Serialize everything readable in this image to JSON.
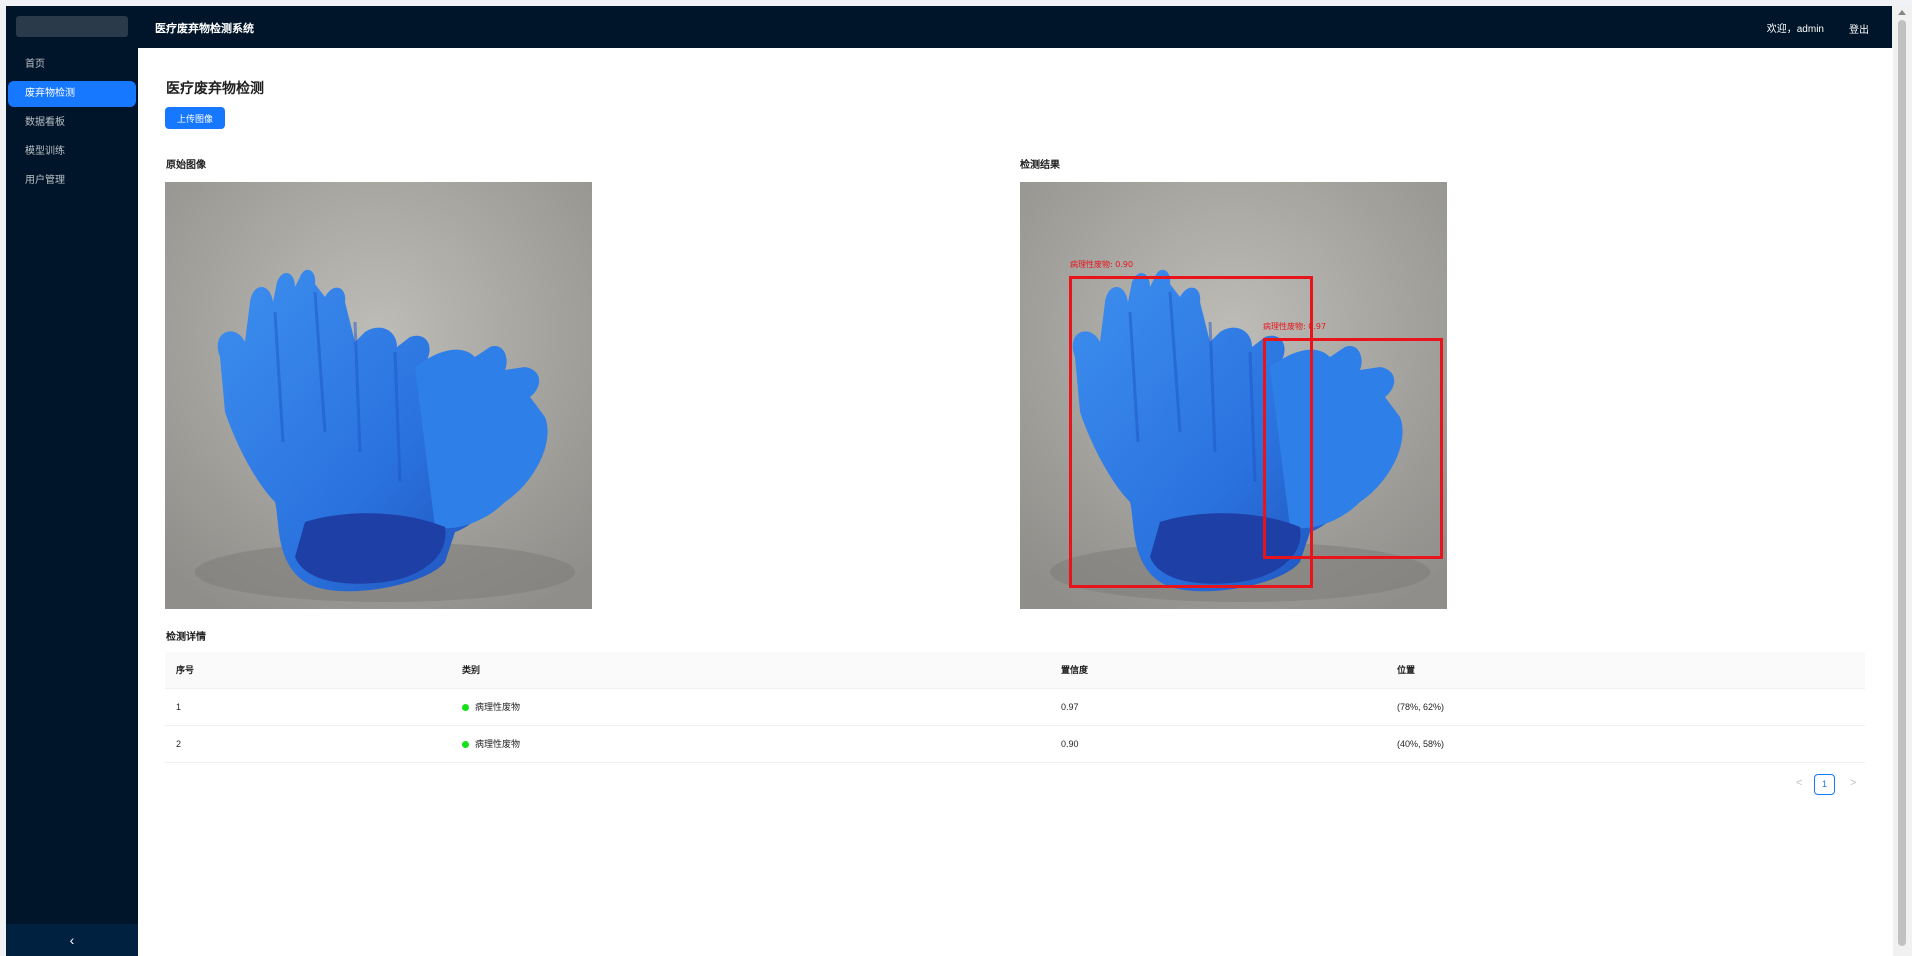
{
  "header": {
    "app_title": "医疗废弃物检测系统",
    "welcome": "欢迎，admin",
    "logout_label": "登出"
  },
  "sidebar": {
    "items": [
      {
        "label": "首页",
        "active": false
      },
      {
        "label": "废弃物检测",
        "active": true
      },
      {
        "label": "数据看板",
        "active": false
      },
      {
        "label": "模型训练",
        "active": false
      },
      {
        "label": "用户管理",
        "active": false
      }
    ],
    "collapse_icon": "chevron-left-icon",
    "collapse_glyph": "‹"
  },
  "main": {
    "page_title": "医疗废弃物检测",
    "upload_label": "上传图像",
    "original_label": "原始图像",
    "result_label": "检测结果",
    "details_label": "检测详情",
    "detections": [
      {
        "label": "病理性废物: 0.90"
      },
      {
        "label": "病理性废物: 0.97"
      }
    ]
  },
  "table": {
    "columns": [
      "序号",
      "类别",
      "置信度",
      "位置"
    ],
    "rows": [
      {
        "index": "1",
        "category": "病理性废物",
        "confidence": "0.97",
        "position": "(78%, 62%)"
      },
      {
        "index": "2",
        "category": "病理性废物",
        "confidence": "0.90",
        "position": "(40%, 58%)"
      }
    ]
  },
  "pagination": {
    "current": "1",
    "prev_glyph": "<",
    "next_glyph": ">"
  },
  "colors": {
    "sidebar_bg": "#001529",
    "accent": "#1677ff",
    "bbox": "#e8141c",
    "status_dot": "#16e016"
  }
}
